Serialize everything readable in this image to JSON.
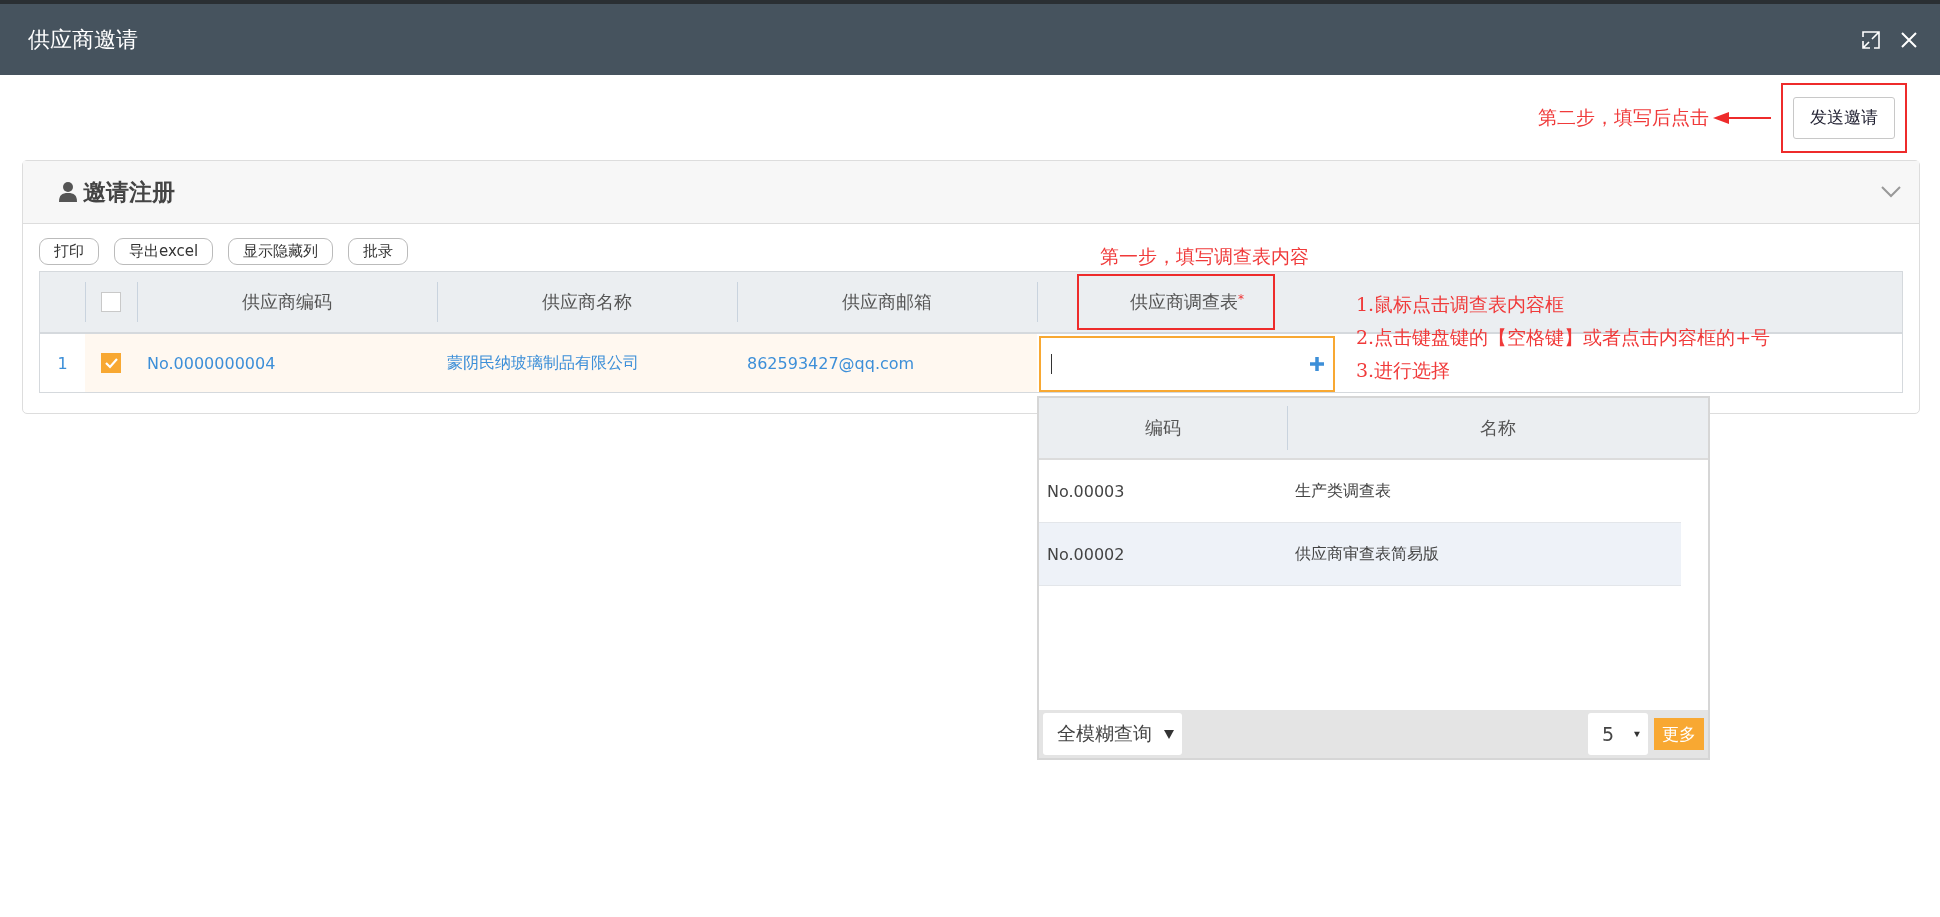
{
  "window": {
    "title": "供应商邀请"
  },
  "send_button": "发送邀请",
  "step2_note": "第二步，填写后点击",
  "panel": {
    "title": "邀请注册"
  },
  "toolbar": [
    "打印",
    "导出excel",
    "显示隐藏列",
    "批录"
  ],
  "step1_note": "第一步，填写调查表内容",
  "instructions": [
    "1.鼠标点击调查表内容框",
    "2.点击键盘键的【空格键】或者点击内容框的+号",
    "3.进行选择"
  ],
  "table": {
    "header_checked": false,
    "columns": [
      {
        "label": "供应商编码"
      },
      {
        "label": "供应商名称"
      },
      {
        "label": "供应商邮箱"
      },
      {
        "label": "供应商调查表",
        "required_mark": "*"
      }
    ],
    "rows": [
      {
        "index": "1",
        "checked": true,
        "code": "No.0000000004",
        "name": "蒙阴民纳玻璃制品有限公司",
        "email": "862593427@qq.com"
      }
    ]
  },
  "lookup": {
    "columns": [
      "编码",
      "名称"
    ],
    "rows": [
      {
        "code": "No.00003",
        "name": "生产类调查表",
        "selected": false
      },
      {
        "code": "No.00002",
        "name": "供应商审查表简易版",
        "selected": true
      }
    ],
    "search_mode": "全模糊查询",
    "page_size": "5",
    "more_button": "更多"
  }
}
